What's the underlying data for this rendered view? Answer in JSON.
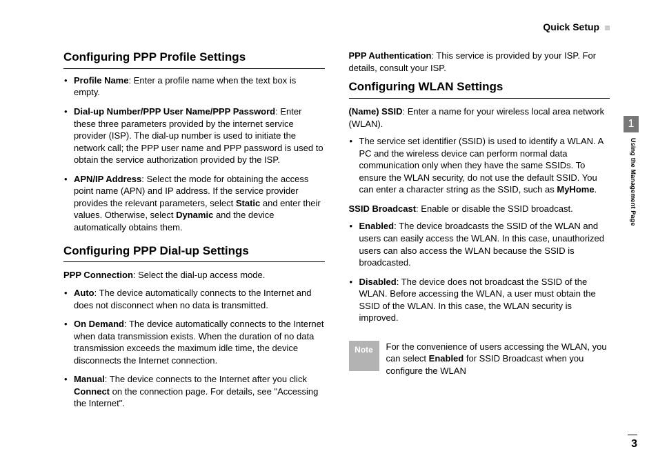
{
  "header": {
    "title": "Quick Setup"
  },
  "sidetab": {
    "number": "1",
    "label": "Using the Management Page"
  },
  "pagenum": "3",
  "col1": {
    "h1": "Configuring PPP Profile Settings",
    "b1_strong": "Profile Name",
    "b1_text": ": Enter a profile name when the text box is empty.",
    "b2_strong": "Dial-up Number/PPP User Name/PPP Password",
    "b2_text": ": Enter these three parameters provided by the internet service provider (ISP). The dial-up number is used to initiate the network call; the PPP user name and PPP password is used to obtain the service authorization provided by the ISP.",
    "b3_strong": "APN/IP Address",
    "b3_t1": ": Select the mode for obtaining the access point name (APN) and IP address. If the service provider provides the relevant parameters, select ",
    "b3_s1": "Static",
    "b3_t2": " and enter their values. Otherwise, select ",
    "b3_s2": "Dynamic",
    "b3_t3": " and the device automatically obtains them.",
    "h2": "Configuring PPP Dial-up Settings",
    "lead_strong": "PPP Connection",
    "lead_text": ": Select the dial-up access mode.",
    "d1_strong": "Auto",
    "d1_text": ": The device automatically connects to the Internet and does not disconnect when no data is transmitted.",
    "d2_strong": "On Demand",
    "d2_text": ": The device automatically connects to the Internet when data transmission exists. When the duration of no data transmission exceeds the maximum idle time, the device disconnects the Internet connection.",
    "d3_strong": "Manual",
    "d3_t1": ": The device connects to the Internet after you click ",
    "d3_s1": "Connect",
    "d3_t2": " on the connection page. For details, see \"Accessing the Internet\"."
  },
  "col2": {
    "p0_strong": "PPP Authentication",
    "p0_text": ": This service is provided by your ISP. For details, consult your ISP.",
    "h1": "Configuring WLAN Settings",
    "lead_strong": "(Name) SSID",
    "lead_text": ": Enter a name for your wireless local area network (WLAN).",
    "s1_t1": "The service set identifier (SSID) is used to identify a WLAN. A PC and the wireless device can perform normal data communication only when they have the same SSIDs. To ensure the WLAN security, do not use the default SSID. You can enter a character string as the SSID, such as ",
    "s1_s1": "MyHome",
    "s1_t2": ".",
    "p1_strong": "SSID Broadcast",
    "p1_text": ": Enable or disable the SSID broadcast.",
    "e1_strong": "Enabled",
    "e1_text": ": The device broadcasts the SSID of the WLAN and users can easily access the WLAN. In this case, unauthorized users can also access the WLAN because the SSID is broadcasted.",
    "e2_strong": "Disabled",
    "e2_text": ": The device does not broadcast the SSID of the WLAN. Before accessing the WLAN, a user must obtain the SSID of the WLAN. In this case, the WLAN security is improved.",
    "note_label": "Note",
    "note_t1": "For the convenience of users accessing the WLAN, you can select ",
    "note_s1": "Enabled",
    "note_t2": " for SSID Broadcast when you configure the WLAN"
  }
}
